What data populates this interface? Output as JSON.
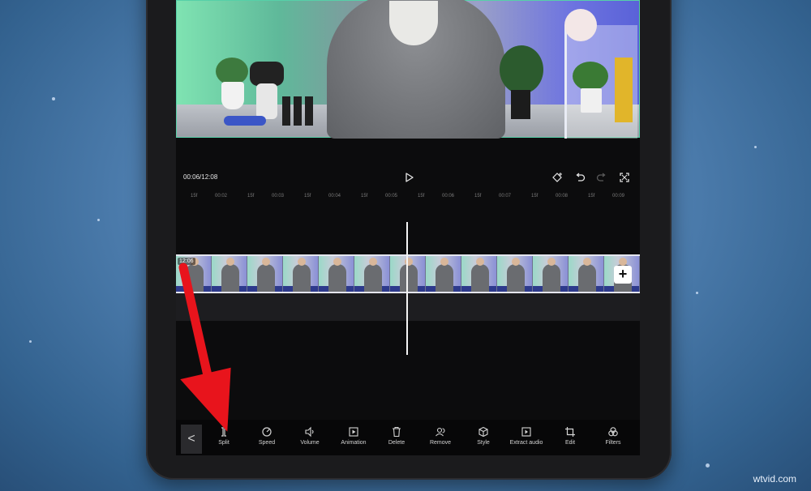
{
  "player": {
    "timecode": "00:06/12:08"
  },
  "controls": {
    "play_icon": "play-icon",
    "keyframe_icon": "keyframe-add-icon",
    "undo_icon": "undo-icon",
    "redo_icon": "redo-icon",
    "fullscreen_icon": "fullscreen-icon"
  },
  "ruler": {
    "ticks": [
      "15f",
      "00:02",
      "15f",
      "00:03",
      "15f",
      "00:04",
      "15f",
      "00:05",
      "15f",
      "00:06",
      "15f",
      "00:07",
      "15f",
      "00:08",
      "15f",
      "00:09"
    ]
  },
  "timeline": {
    "clip_duration": "12:06",
    "add_clip_label": "+"
  },
  "toolbar": {
    "back_label": "<",
    "tools": [
      {
        "label": "Split",
        "icon": "split-icon"
      },
      {
        "label": "Speed",
        "icon": "speed-icon"
      },
      {
        "label": "Volume",
        "icon": "volume-icon"
      },
      {
        "label": "Animation",
        "icon": "animation-icon"
      },
      {
        "label": "Delete",
        "icon": "delete-icon"
      },
      {
        "label": "Remove",
        "icon": "remove-icon"
      },
      {
        "label": "Style",
        "icon": "style-icon"
      },
      {
        "label": "Extract audio",
        "icon": "extract-audio-icon"
      },
      {
        "label": "Edit",
        "icon": "crop-icon"
      },
      {
        "label": "Filters",
        "icon": "filters-icon"
      }
    ]
  },
  "watermark": "wtvid.com",
  "colors": {
    "annotation_arrow": "#e8141c",
    "background": "#4f7fb0",
    "panel": "#0c0c0d"
  }
}
